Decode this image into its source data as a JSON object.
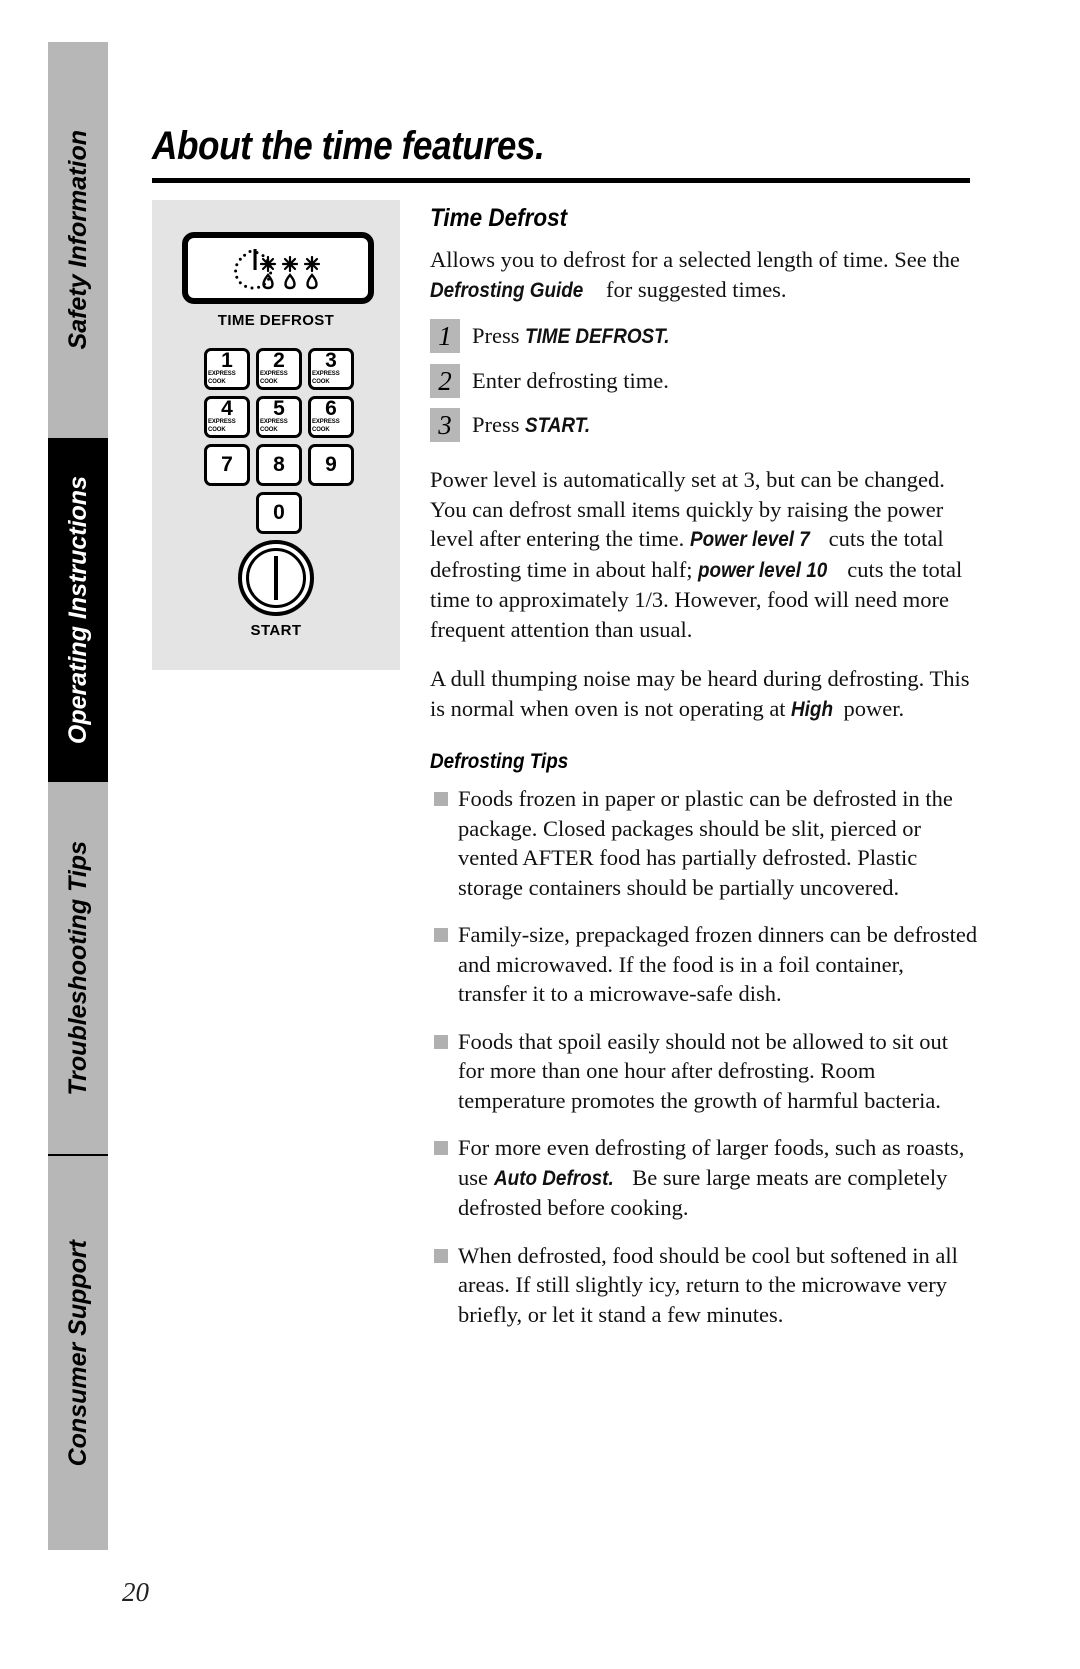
{
  "page": {
    "title": "About the time features.",
    "number": "20"
  },
  "sidebar": {
    "tabs": [
      {
        "label": "Safety Information",
        "active": false
      },
      {
        "label": "Operating Instructions",
        "active": true
      },
      {
        "label": "Troubleshooting Tips",
        "active": false
      },
      {
        "label": "Consumer Support",
        "active": false
      }
    ]
  },
  "panel": {
    "defrost_button_caption": "TIME DEFROST",
    "defrost_icon": "clock-snowflake-droplet-icon",
    "keys": [
      {
        "num": "1",
        "sub": "EXPRESS COOK"
      },
      {
        "num": "2",
        "sub": "EXPRESS COOK"
      },
      {
        "num": "3",
        "sub": "EXPRESS COOK"
      },
      {
        "num": "4",
        "sub": "EXPRESS COOK"
      },
      {
        "num": "5",
        "sub": "EXPRESS COOK"
      },
      {
        "num": "6",
        "sub": "EXPRESS COOK"
      },
      {
        "num": "7",
        "sub": ""
      },
      {
        "num": "8",
        "sub": ""
      },
      {
        "num": "9",
        "sub": ""
      },
      {
        "num": "0",
        "sub": ""
      }
    ],
    "start_caption": "START",
    "start_icon": "power-button-icon"
  },
  "content": {
    "section_heading": "Time Defrost",
    "intro_1": "Allows you to defrost for a selected length of time.",
    "intro_2_before": "See the ",
    "intro_2_em": "Defrosting Guide",
    "intro_2_after": " for suggested times.",
    "steps": [
      {
        "number": "1",
        "before": "Press ",
        "em": "TIME DEFROST.",
        "after": ""
      },
      {
        "number": "2",
        "before": "Enter defrosting time.",
        "em": "",
        "after": ""
      },
      {
        "number": "3",
        "before": "Press ",
        "em": "START.",
        "after": ""
      }
    ],
    "power_para_a": "Power level is automatically set at 3, but can be changed. You can defrost small items quickly by raising the power level after entering the time. ",
    "power_para_em1": "Power level 7",
    "power_para_b": " cuts the total defrosting time in about half; ",
    "power_para_em2": "power level 10",
    "power_para_c": " cuts the total time to approximately 1/3. However, food will need more frequent attention than usual.",
    "noise_para_a": "A dull thumping noise may be heard during defrosting. This is normal when oven is not operating at ",
    "noise_para_em": "High",
    "noise_para_b": " power.",
    "tips_heading": "Defrosting Tips",
    "tips": [
      {
        "text_a": "Foods frozen in paper or plastic can be defrosted in the package. Closed packages should be slit, pierced or vented AFTER food has partially defrosted. Plastic storage containers should be partially uncovered.",
        "em": "",
        "text_b": ""
      },
      {
        "text_a": "Family-size, prepackaged frozen dinners can be defrosted and microwaved. If the food is in a foil container, transfer it to a microwave-safe dish.",
        "em": "",
        "text_b": ""
      },
      {
        "text_a": "Foods that spoil easily should not be allowed to sit out for more than one hour after defrosting. Room temperature promotes the growth of harmful bacteria.",
        "em": "",
        "text_b": ""
      },
      {
        "text_a": "For more even defrosting of larger foods, such as roasts, use ",
        "em": "Auto Defrost.",
        "text_b": " Be sure large meats are completely defrosted before cooking."
      },
      {
        "text_a": "When defrosted, food should be cool but softened in all areas. If still slightly icy, return to the microwave very briefly, or let it stand a few minutes.",
        "em": "",
        "text_b": ""
      }
    ]
  },
  "colors": {
    "tab_inactive": "#b7b7b7",
    "tab_active": "#000000",
    "panel_bg": "#e4e4e4",
    "bullet": "#b0b0b0"
  }
}
